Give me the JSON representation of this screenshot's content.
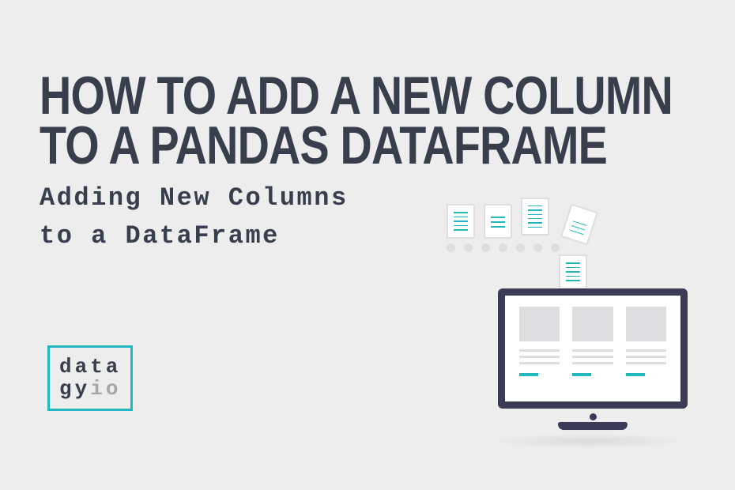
{
  "title_line1": "HOW TO ADD A NEW COLUMN",
  "title_line2": "TO A PANDAS DATAFRAME",
  "subtitle_line1": "Adding New Columns",
  "subtitle_line2": "to a DataFrame",
  "logo": {
    "line1": "data",
    "line2_part1": "gy",
    "line2_part2": "io"
  }
}
